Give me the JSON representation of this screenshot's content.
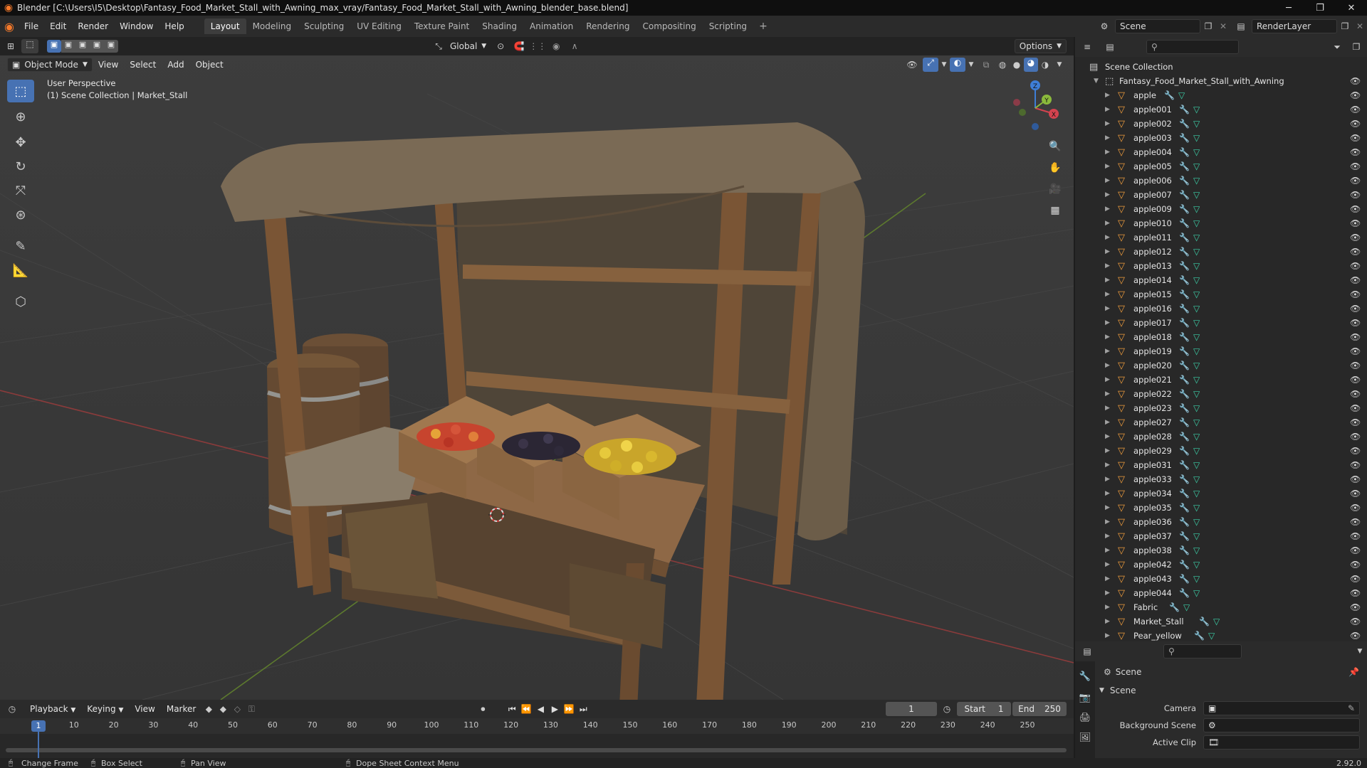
{
  "window": {
    "title": "Blender [C:\\Users\\I5\\Desktop\\Fantasy_Food_Market_Stall_with_Awning_max_vray/Fantasy_Food_Market_Stall_with_Awning_blender_base.blend]",
    "controls": [
      "minimize",
      "restore",
      "close"
    ]
  },
  "menubar": {
    "menus": [
      "File",
      "Edit",
      "Render",
      "Window",
      "Help"
    ],
    "workspaces": [
      "Layout",
      "Modeling",
      "Sculpting",
      "UV Editing",
      "Texture Paint",
      "Shading",
      "Animation",
      "Rendering",
      "Compositing",
      "Scripting"
    ],
    "active_workspace": "Layout",
    "add_workspace": "+",
    "scene": "Scene",
    "view_layer": "RenderLayer"
  },
  "viewport": {
    "transform_orientation": "Global",
    "options_label": "Options",
    "mode": "Object Mode",
    "menus": [
      "View",
      "Select",
      "Add",
      "Object"
    ],
    "overlay_line1": "User Perspective",
    "overlay_line2": "(1) Scene Collection | Market_Stall",
    "gizmo_axes": [
      "X",
      "Y",
      "Z"
    ],
    "tools": [
      "select-box",
      "cursor",
      "move",
      "rotate",
      "scale",
      "transform",
      "annotate",
      "measure",
      "add-cube"
    ]
  },
  "outliner": {
    "root": "Scene Collection",
    "collection": "Fantasy_Food_Market_Stall_with_Awning",
    "items": [
      "apple",
      "apple001",
      "apple002",
      "apple003",
      "apple004",
      "apple005",
      "apple006",
      "apple007",
      "apple009",
      "apple010",
      "apple011",
      "apple012",
      "apple013",
      "apple014",
      "apple015",
      "apple016",
      "apple017",
      "apple018",
      "apple019",
      "apple020",
      "apple021",
      "apple022",
      "apple023",
      "apple027",
      "apple028",
      "apple029",
      "apple031",
      "apple033",
      "apple034",
      "apple035",
      "apple036",
      "apple037",
      "apple038",
      "apple042",
      "apple043",
      "apple044",
      "Fabric",
      "Market_Stall",
      "Pear_yellow"
    ]
  },
  "properties": {
    "context": "Scene",
    "panel": "Scene",
    "fields": [
      "Camera",
      "Background Scene",
      "Active Clip"
    ],
    "version": "2.92.0"
  },
  "timeline": {
    "menus": [
      "Playback",
      "Keying",
      "View",
      "Marker"
    ],
    "current_frame": "1",
    "start_label": "Start",
    "start_value": "1",
    "end_label": "End",
    "end_value": "250",
    "ruler": [
      "1",
      "10",
      "20",
      "30",
      "40",
      "50",
      "60",
      "70",
      "80",
      "90",
      "100",
      "110",
      "120",
      "130",
      "140",
      "150",
      "160",
      "170",
      "180",
      "190",
      "200",
      "210",
      "220",
      "230",
      "240",
      "250"
    ]
  },
  "statusbar": {
    "hints": [
      "Change Frame",
      "Box Select",
      "Pan View",
      "Dope Sheet Context Menu"
    ]
  },
  "colors": {
    "accent": "#4772b3",
    "blender_orange": "#f5792a",
    "playhead": "#4772b3",
    "x_axis": "#d4434f",
    "y_axis": "#8bba3c",
    "z_axis": "#3e7ed6"
  }
}
